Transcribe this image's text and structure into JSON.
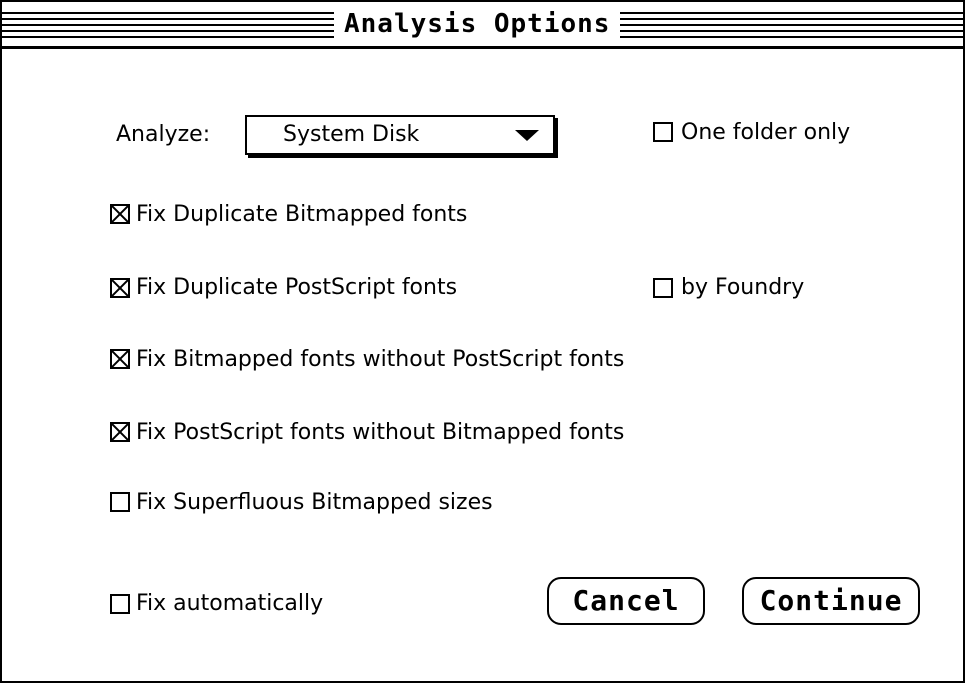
{
  "window": {
    "title": "Analysis Options"
  },
  "analyze": {
    "label": "Analyze:",
    "selected": "System Disk"
  },
  "options": {
    "one_folder_only": {
      "label": "One folder only",
      "checked": false
    },
    "fix_dup_bitmapped": {
      "label": "Fix Duplicate Bitmapped fonts",
      "checked": true
    },
    "fix_dup_postscript": {
      "label": "Fix Duplicate PostScript fonts",
      "checked": true
    },
    "by_foundry": {
      "label": "by Foundry",
      "checked": false
    },
    "fix_bitmapped_without_ps": {
      "label": "Fix Bitmapped fonts without PostScript fonts",
      "checked": true
    },
    "fix_ps_without_bitmapped": {
      "label": "Fix PostScript fonts without Bitmapped fonts",
      "checked": true
    },
    "fix_superfluous_sizes": {
      "label": "Fix Superfluous Bitmapped sizes",
      "checked": false
    },
    "fix_automatically": {
      "label": "Fix automatically",
      "checked": false
    }
  },
  "buttons": {
    "cancel": "Cancel",
    "continue": "Continue"
  },
  "icons": {
    "checkmark": "x-cross-icon",
    "popup_arrow": "triangle-down-icon"
  }
}
